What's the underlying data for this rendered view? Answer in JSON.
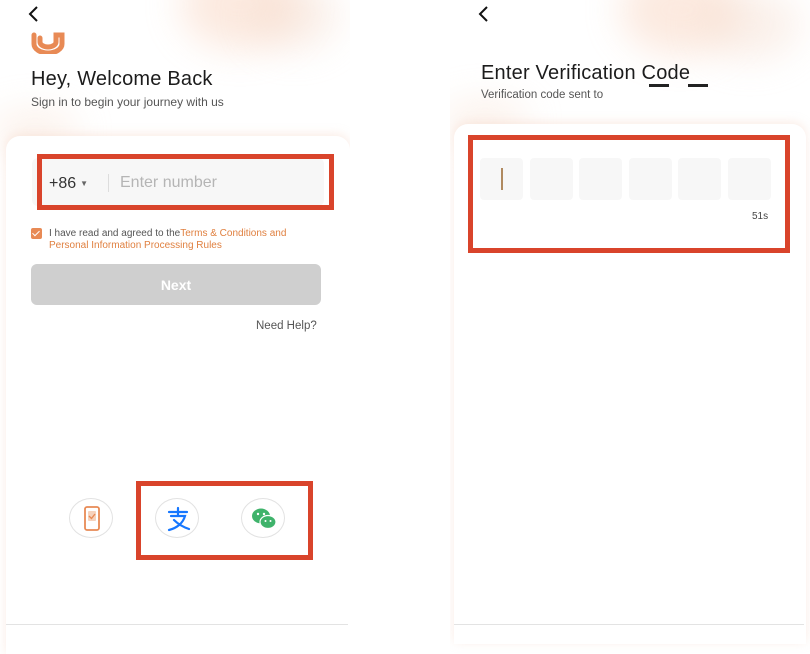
{
  "login": {
    "back_icon": "chevron-left-icon",
    "title": "Hey, Welcome Back",
    "subtitle": "Sign in to begin your journey with us",
    "country_code": "+86",
    "phone_placeholder": "Enter number",
    "agree_text": "I have read and agreed to the",
    "terms_link": "Terms & Conditions and Personal Information Processing Rules",
    "next_label": "Next",
    "help_label": "Need Help?",
    "social": [
      {
        "name": "sim-card-icon"
      },
      {
        "name": "alipay-icon"
      },
      {
        "name": "wechat-icon"
      }
    ]
  },
  "verify": {
    "back_icon": "chevron-left-icon",
    "title": "Enter Verification Code",
    "subtitle": "Verification code sent to",
    "code_slots": 6,
    "timer": "51s"
  },
  "colors": {
    "accent": "#e88a55",
    "highlight_border": "#d9442b",
    "disabled_button": "#cfcfcf",
    "input_bg": "#f7f7f7"
  }
}
